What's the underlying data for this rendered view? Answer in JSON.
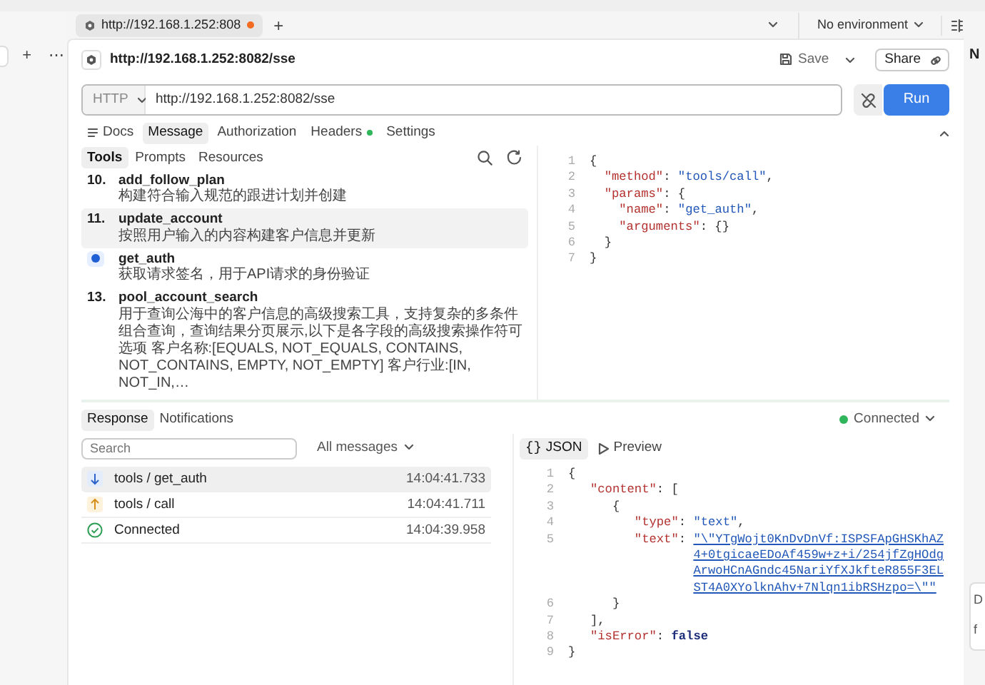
{
  "sidebar": {
    "buttons": [
      "+",
      "⋯"
    ]
  },
  "tab": {
    "title": "http://192.168.1.252:808",
    "unsaved": true
  },
  "new_tab": "+",
  "environment": "No environment",
  "request": {
    "title": "http://192.168.1.252:8082/sse",
    "save": "Save",
    "share": "Share"
  },
  "url_bar": {
    "protocol": "HTTP",
    "url": "http://192.168.1.252:8082/sse",
    "run": "Run"
  },
  "request_tabs": [
    {
      "label": "Docs",
      "kind": "docs",
      "dot": false,
      "selected": false
    },
    {
      "label": "Message",
      "kind": "plain",
      "dot": false,
      "selected": true
    },
    {
      "label": "Authorization",
      "kind": "plain",
      "dot": false,
      "selected": false
    },
    {
      "label": "Headers",
      "kind": "plain",
      "dot": true,
      "selected": false
    },
    {
      "label": "Settings",
      "kind": "plain",
      "dot": false,
      "selected": false
    }
  ],
  "tool_tabs": [
    {
      "label": "Tools",
      "selected": true
    },
    {
      "label": "Prompts",
      "selected": false
    },
    {
      "label": "Resources",
      "selected": false
    }
  ],
  "tools": [
    {
      "kind": "numbered",
      "number": "10.",
      "name": "add_follow_plan",
      "description": "构建符合输入规范的跟进计划并创建",
      "selected": false
    },
    {
      "kind": "numbered",
      "number": "11.",
      "name": "update_account",
      "description": "按照用户输入的内容构建客户信息并更新",
      "selected": true
    },
    {
      "kind": "current",
      "name": "get_auth",
      "description": "获取请求签名，用于API请求的身份验证",
      "selected": false
    },
    {
      "kind": "numbered",
      "number": "13.",
      "name": "pool_account_search",
      "description": "用于查询公海中的客户信息的高级搜索工具，支持复杂的多条件组合查询，查询结果分页展示,以下是各字段的高级搜索操作符可选项 客户名称:[EQUALS, NOT_EQUALS, CONTAINS, NOT_CONTAINS, EMPTY, NOT_EMPTY] 客户行业:[IN, NOT_IN,…",
      "selected": false
    }
  ],
  "message_code": [
    {
      "number": "1",
      "tokens": [
        {
          "t": "{",
          "kind": "punct"
        }
      ]
    },
    {
      "number": "2",
      "tokens": [
        {
          "t": "  \"method\"",
          "kind": "key"
        },
        {
          "t": ": ",
          "kind": "punct"
        },
        {
          "t": "\"tools/call\"",
          "kind": "string"
        },
        {
          "t": ",",
          "kind": "punct"
        }
      ]
    },
    {
      "number": "3",
      "tokens": [
        {
          "t": "  \"params\"",
          "kind": "key"
        },
        {
          "t": ": {",
          "kind": "punct"
        }
      ]
    },
    {
      "number": "4",
      "tokens": [
        {
          "t": "    \"name\"",
          "kind": "key"
        },
        {
          "t": ": ",
          "kind": "punct"
        },
        {
          "t": "\"get_auth\"",
          "kind": "string"
        },
        {
          "t": ",",
          "kind": "punct"
        }
      ]
    },
    {
      "number": "5",
      "tokens": [
        {
          "t": "    \"arguments\"",
          "kind": "key"
        },
        {
          "t": ": {}",
          "kind": "punct"
        }
      ]
    },
    {
      "number": "6",
      "tokens": [
        {
          "t": "  }",
          "kind": "punct"
        }
      ]
    },
    {
      "number": "7",
      "tokens": [
        {
          "t": "}",
          "kind": "punct"
        }
      ]
    }
  ],
  "response_tabs": [
    {
      "label": "Response",
      "selected": true
    },
    {
      "label": "Notifications",
      "selected": false
    }
  ],
  "connection": {
    "label": "Connected",
    "connected": true
  },
  "filter": {
    "placeholder": "Search",
    "scope": "All messages"
  },
  "messages": [
    {
      "kind": "in",
      "label": "tools / get_auth",
      "time": "14:04:41.733",
      "selected": true
    },
    {
      "kind": "out",
      "label": "tools / call",
      "time": "14:04:41.711",
      "selected": false
    },
    {
      "kind": "connected",
      "label": "Connected",
      "time": "14:04:39.958",
      "selected": false
    }
  ],
  "view_tabs": [
    {
      "kind": "json",
      "glyph": "{}",
      "label": "JSON",
      "selected": true
    },
    {
      "kind": "preview",
      "label": "Preview",
      "selected": false
    }
  ],
  "response_code": [
    {
      "number": "1",
      "tokens": [
        {
          "t": "{",
          "kind": "punct"
        }
      ]
    },
    {
      "number": "2",
      "tokens": [
        {
          "t": "   \"content\"",
          "kind": "key"
        },
        {
          "t": ": [",
          "kind": "punct"
        }
      ]
    },
    {
      "number": "3",
      "tokens": [
        {
          "t": "      {",
          "kind": "punct"
        }
      ]
    },
    {
      "number": "4",
      "tokens": [
        {
          "t": "         \"type\"",
          "kind": "key"
        },
        {
          "t": ": ",
          "kind": "punct"
        },
        {
          "t": "\"text\"",
          "kind": "string"
        },
        {
          "t": ",",
          "kind": "punct"
        }
      ]
    },
    {
      "number": "5",
      "tokens": [
        {
          "t": "         \"text\"",
          "kind": "key"
        },
        {
          "t": ": ",
          "kind": "punct"
        },
        {
          "t": "\"\\\"YTgWojt0KnDvDnVf:ISPSFApGHSKhAZ4+0tgicaeEDoAf459w+z+i/254jfZgHOdgArwoHCnAGndc45NariYfXJkfteR855F3ELST4A0XYolknAhv+7Nlqn1ibRSHzpo=\\\"\"",
          "kind": "long"
        }
      ]
    },
    {
      "number": "6",
      "tokens": [
        {
          "t": "      }",
          "kind": "punct"
        }
      ]
    },
    {
      "number": "7",
      "tokens": [
        {
          "t": "   ],",
          "kind": "punct"
        }
      ]
    },
    {
      "number": "8",
      "tokens": [
        {
          "t": "   \"isError\"",
          "kind": "key"
        },
        {
          "t": ": ",
          "kind": "punct"
        },
        {
          "t": "false",
          "kind": "keyword"
        }
      ]
    },
    {
      "number": "9",
      "tokens": [
        {
          "t": "}",
          "kind": "punct"
        }
      ]
    }
  ],
  "right_panel": {
    "header": "N",
    "card_lines": [
      "D",
      "f"
    ]
  }
}
